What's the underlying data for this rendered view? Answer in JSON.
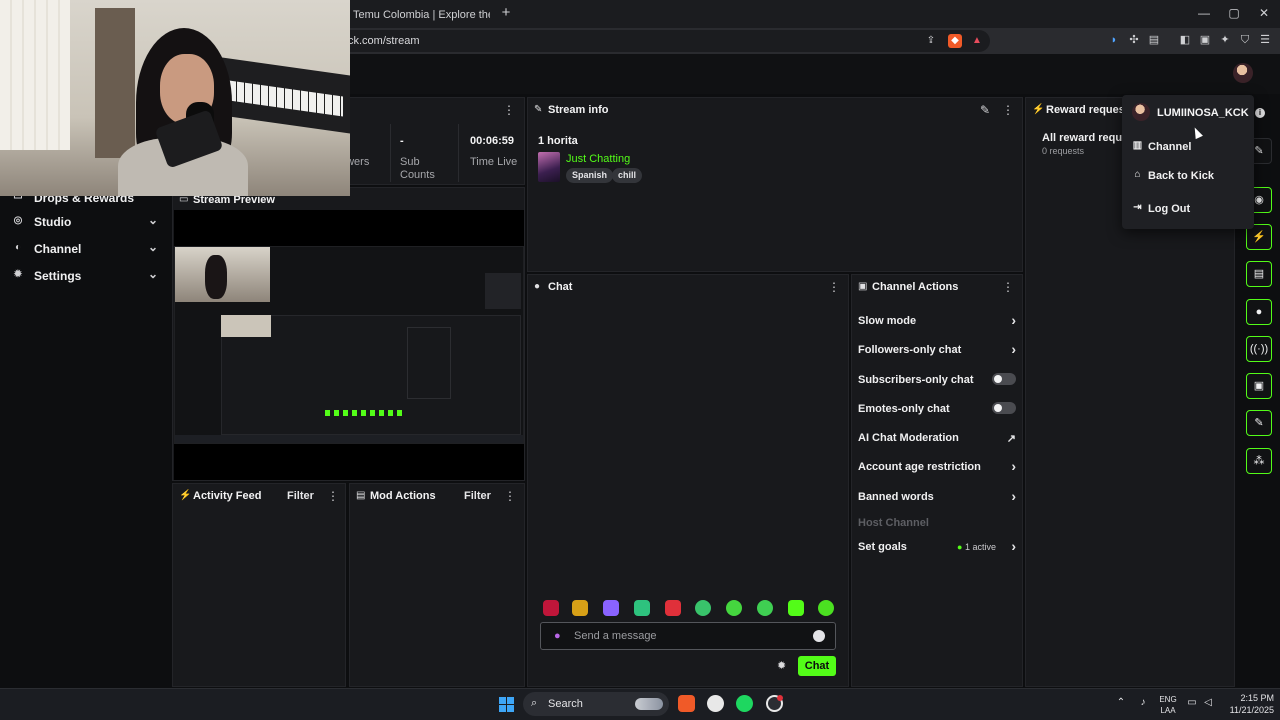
{
  "browser": {
    "tab_title": "Temu Colombia | Explore the Latest C",
    "new_tab": "+",
    "url": "ck.com/stream",
    "window_controls": [
      "—",
      "▢",
      "✕"
    ]
  },
  "sidebar": {
    "items": [
      {
        "label": "Drops & Rewards",
        "icon": "gift-icon"
      },
      {
        "label": "Studio",
        "icon": "studio-icon"
      },
      {
        "label": "Channel",
        "icon": "channel-icon"
      },
      {
        "label": "Settings",
        "icon": "gear-icon"
      }
    ]
  },
  "stats": {
    "followers_label": "owers",
    "sub_counts_value": "-",
    "sub_counts_label_1": "Sub",
    "sub_counts_label_2": "Counts",
    "time_live_value": "00:06:59",
    "time_live_label": "Time Live"
  },
  "stream_preview": {
    "title": "Stream Preview"
  },
  "stream_info": {
    "title": "Stream info",
    "stream_title": "1 horita",
    "category": "Just Chatting",
    "tags": [
      "Spanish",
      "chill"
    ]
  },
  "reward_requests": {
    "title": "Reward request",
    "heading": "All reward reques",
    "count": "0 requests"
  },
  "chat": {
    "title": "Chat",
    "placeholder": "Send a message",
    "send_label": "Chat"
  },
  "channel_actions": {
    "title": "Channel Actions",
    "items": [
      {
        "label": "Slow mode",
        "control": "arrow"
      },
      {
        "label": "Followers-only chat",
        "control": "arrow"
      },
      {
        "label": "Subscribers-only chat",
        "control": "toggle",
        "state": "off"
      },
      {
        "label": "Emotes-only chat",
        "control": "toggle",
        "state": "off"
      },
      {
        "label": "AI Chat Moderation",
        "control": "external"
      },
      {
        "label": "Account age restriction",
        "control": "arrow"
      },
      {
        "label": "Banned words",
        "control": "arrow"
      },
      {
        "label": "Host Channel",
        "control": "none",
        "disabled": true
      },
      {
        "label": "Set goals",
        "control": "arrow",
        "badge": "1 active"
      }
    ]
  },
  "activity_feed": {
    "title": "Activity Feed",
    "filter": "Filter"
  },
  "mod_actions": {
    "title": "Mod Actions",
    "filter": "Filter"
  },
  "user_menu": {
    "username": "LUMIINOSA_KCK",
    "items": [
      {
        "label": "Channel",
        "icon": "channel-icon"
      },
      {
        "label": "Back to Kick",
        "icon": "home-icon"
      },
      {
        "label": "Log Out",
        "icon": "logout-icon"
      }
    ]
  },
  "taskbar": {
    "search_label": "Search",
    "language_1": "ENG",
    "language_2": "LAA",
    "time": "2:15 PM",
    "date": "11/21/2025"
  },
  "colors": {
    "accent": "#53fc18",
    "panel": "#18191c",
    "background": "#0d0e10"
  }
}
